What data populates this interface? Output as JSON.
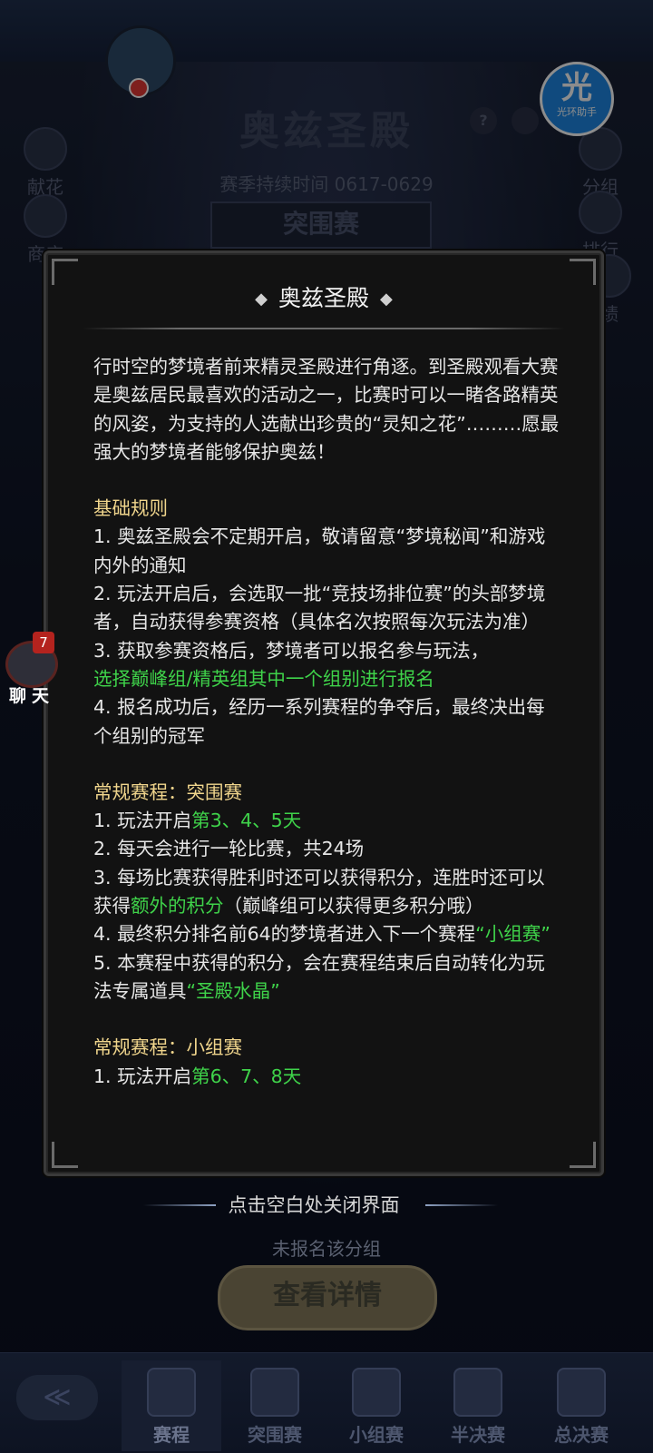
{
  "game": {
    "title": "奥兹圣殿",
    "season": "赛季持续时间 0617-0629",
    "stage_tab": "突围赛",
    "help_icon": "?",
    "left_buttons": [
      {
        "label": "献花",
        "icon": "flower-icon"
      },
      {
        "label": "商店",
        "icon": "shop-icon"
      }
    ],
    "right_buttons": [
      {
        "label": "分组",
        "icon": "group-icon"
      },
      {
        "label": "排行",
        "icon": "ranking-icon"
      },
      {
        "label": "绩",
        "icon": "record-icon"
      }
    ],
    "assistant": {
      "big": "光",
      "small": "光环助手"
    },
    "not_signed": "未报名该分组",
    "detail_button": "查看详情",
    "close_hint": "点击空白处关闭界面"
  },
  "chat": {
    "label": "聊天",
    "badge": "7"
  },
  "modal": {
    "title": "奥兹圣殿",
    "intro": "行时空的梦境者前来精灵圣殿进行角逐。到圣殿观看大赛是奥兹居民最喜欢的活动之一，比赛时可以一睹各路精英的风姿，为支持的人选献出珍贵的“灵知之花”………愿最强大的梦境者能够保护奥兹！",
    "basic_rules": {
      "heading": "基础规则",
      "r1": "1. 奥兹圣殿会不定期开启，敬请留意“梦境秘闻”和游戏内外的通知",
      "r2": "2. 玩法开启后，会选取一批“竞技场排位赛”的头部梦境者，自动获得参赛资格（具体名次按照每次玩法为准）",
      "r3a": "3. 获取参赛资格后，梦境者可以报名参与玩法，",
      "r3b": "选择巅峰组/精英组其中一个组别进行报名",
      "r4": "4. 报名成功后，经历一系列赛程的争夺后，最终决出每个组别的冠军"
    },
    "breakout": {
      "heading": "常规赛程：突围赛",
      "r1a": "1. 玩法开启",
      "r1b": "第3、4、5天",
      "r2": "2. 每天会进行一轮比赛，共24场",
      "r3a": "3. 每场比赛获得胜利时还可以获得积分，连胜时还可以获得",
      "r3b": "额外的积分",
      "r3c": "（巅峰组可以获得更多积分哦）",
      "r4a": "4. 最终积分排名前64的梦境者进入下一个赛程",
      "r4b": "“小组赛”",
      "r5a": "5. 本赛程中获得的积分，会在赛程结束后自动转化为玩法专属道具",
      "r5b": "“圣殿水晶”"
    },
    "group": {
      "heading": "常规赛程：小组赛",
      "r1a": "1. 玩法开启",
      "r1b": "第6、7、8天"
    }
  },
  "bottom_nav": {
    "back_icon": "back-icon",
    "items": [
      {
        "label": "赛程",
        "icon": "schedule-icon",
        "active": true
      },
      {
        "label": "突围赛",
        "icon": "breakout-icon"
      },
      {
        "label": "小组赛",
        "icon": "group-stage-icon"
      },
      {
        "label": "半决赛",
        "icon": "semifinal-icon"
      },
      {
        "label": "总决赛",
        "icon": "final-icon"
      }
    ]
  },
  "colors": {
    "highlight_green": "#3fd34a",
    "heading_gold": "#f0d58c",
    "badge_red": "#b4231e"
  }
}
